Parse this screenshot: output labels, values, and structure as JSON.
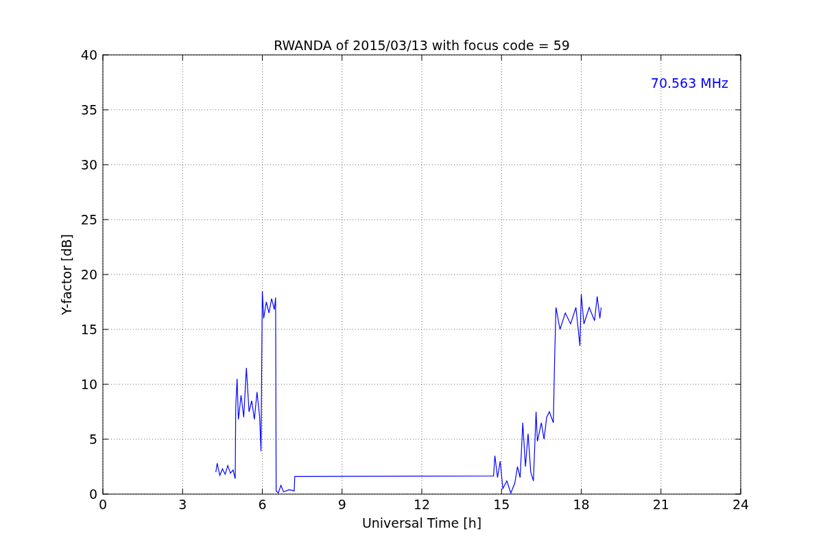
{
  "chart_data": {
    "type": "line",
    "title": "RWANDA of 2015/03/13 with focus code = 59",
    "xlabel": "Universal Time [h]",
    "ylabel": "Y-factor [dB]",
    "xlim": [
      0,
      24
    ],
    "ylim": [
      0,
      40
    ],
    "grid": true,
    "xticks": [
      0,
      3,
      6,
      9,
      12,
      15,
      18,
      21,
      24
    ],
    "yticks": [
      0,
      5,
      10,
      15,
      20,
      25,
      30,
      35,
      40
    ],
    "x": [
      4.25,
      4.3,
      4.4,
      4.5,
      4.6,
      4.7,
      4.8,
      4.9,
      4.98,
      5.0,
      5.05,
      5.1,
      5.2,
      5.3,
      5.4,
      5.5,
      5.6,
      5.7,
      5.8,
      5.9,
      5.95,
      6.0,
      6.05,
      6.15,
      6.25,
      6.35,
      6.45,
      6.5,
      6.52,
      6.6,
      6.7,
      6.8,
      7.0,
      7.2,
      7.22,
      14.7,
      14.75,
      14.85,
      14.95,
      15.05,
      15.2,
      15.35,
      15.5,
      15.6,
      15.7,
      15.8,
      15.9,
      16.0,
      16.1,
      16.2,
      16.3,
      16.35,
      16.5,
      16.6,
      16.7,
      16.8,
      16.95,
      17.0,
      17.05,
      17.2,
      17.4,
      17.6,
      17.8,
      17.95,
      18.0,
      18.1,
      18.3,
      18.5,
      18.6,
      18.7,
      18.75
    ],
    "series": [
      {
        "name": "70.563 MHz",
        "color": "#0000ff",
        "values": [
          2.0,
          2.8,
          1.7,
          2.3,
          1.8,
          2.6,
          1.9,
          2.2,
          1.4,
          8.0,
          10.5,
          6.8,
          9.0,
          7.0,
          11.5,
          7.5,
          8.5,
          6.8,
          9.3,
          7.0,
          3.9,
          18.5,
          16.0,
          17.5,
          16.5,
          17.8,
          16.8,
          17.9,
          0.3,
          0.1,
          0.8,
          0.2,
          0.4,
          0.3,
          1.6,
          1.65,
          3.5,
          1.5,
          3.0,
          0.5,
          1.2,
          0.1,
          1.0,
          2.5,
          1.5,
          6.5,
          2.5,
          5.5,
          2.0,
          1.2,
          7.5,
          4.8,
          6.5,
          5.0,
          7.0,
          7.5,
          6.5,
          12.5,
          17.0,
          15.0,
          16.5,
          15.5,
          17.0,
          13.5,
          18.2,
          15.5,
          17.0,
          15.8,
          18.0,
          16.0,
          17.0
        ]
      }
    ]
  }
}
